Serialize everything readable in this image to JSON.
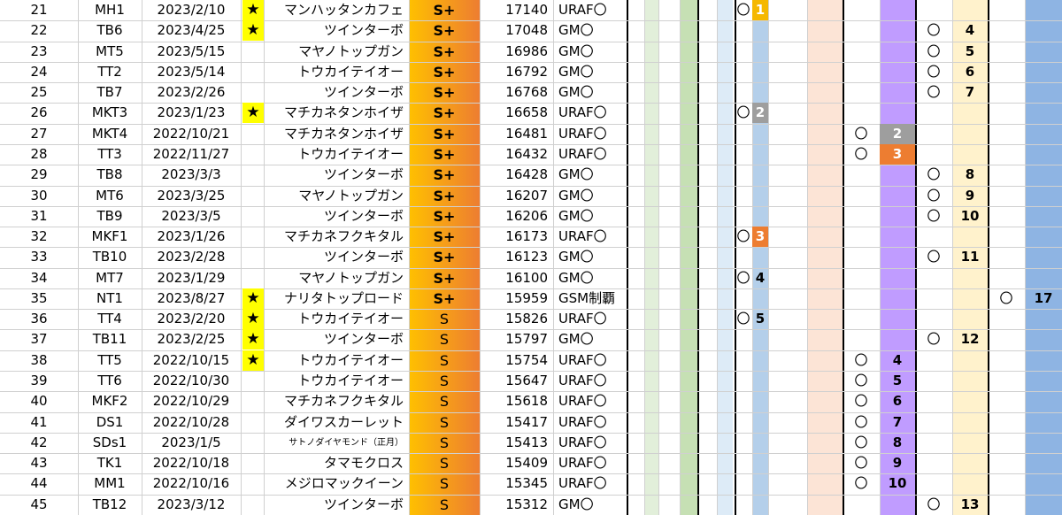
{
  "rows": [
    {
      "no": "21",
      "code": "MH1",
      "date": "2023/2/10",
      "star": "★",
      "name": "マンハッタンカフェ",
      "grade": "S+",
      "score": "17140",
      "cond": "URAF〇",
      "g2": "〇",
      "g2num": "1",
      "g2color": "#f5b800"
    },
    {
      "no": "22",
      "code": "TB6",
      "date": "2023/4/25",
      "star": "★",
      "name": "ツインターボ",
      "grade": "S+",
      "score": "17048",
      "cond": "GM〇",
      "g4": "〇",
      "g4num": "4"
    },
    {
      "no": "23",
      "code": "MT5",
      "date": "2023/5/15",
      "star": "",
      "name": "マヤノトップガン",
      "grade": "S+",
      "score": "16986",
      "cond": "GM〇",
      "g4": "〇",
      "g4num": "5"
    },
    {
      "no": "24",
      "code": "TT2",
      "date": "2023/5/14",
      "star": "",
      "name": "トウカイテイオー",
      "grade": "S+",
      "score": "16792",
      "cond": "GM〇",
      "g4": "〇",
      "g4num": "6"
    },
    {
      "no": "25",
      "code": "TB7",
      "date": "2023/2/26",
      "star": "",
      "name": "ツインターボ",
      "grade": "S+",
      "score": "16768",
      "cond": "GM〇",
      "g4": "〇",
      "g4num": "7"
    },
    {
      "no": "26",
      "code": "MKT3",
      "date": "2023/1/23",
      "star": "★",
      "name": "マチカネタンホイザ",
      "grade": "S+",
      "score": "16658",
      "cond": "URAF〇",
      "g2": "〇",
      "g2num": "2",
      "g2color": "#9e9e9e"
    },
    {
      "no": "27",
      "code": "MKT4",
      "date": "2022/10/21",
      "star": "",
      "name": "マチカネタンホイザ",
      "grade": "S+",
      "score": "16481",
      "cond": "URAF〇",
      "g3": "〇",
      "g3num": "2",
      "g3color": "#9e9e9e"
    },
    {
      "no": "28",
      "code": "TT3",
      "date": "2022/11/27",
      "star": "",
      "name": "トウカイテイオー",
      "grade": "S+",
      "score": "16432",
      "cond": "URAF〇",
      "g3": "〇",
      "g3num": "3",
      "g3color": "#ed7d31"
    },
    {
      "no": "29",
      "code": "TB8",
      "date": "2023/3/3",
      "star": "",
      "name": "ツインターボ",
      "grade": "S+",
      "score": "16428",
      "cond": "GM〇",
      "g4": "〇",
      "g4num": "8"
    },
    {
      "no": "30",
      "code": "MT6",
      "date": "2023/3/25",
      "star": "",
      "name": "マヤノトップガン",
      "grade": "S+",
      "score": "16207",
      "cond": "GM〇",
      "g4": "〇",
      "g4num": "9"
    },
    {
      "no": "31",
      "code": "TB9",
      "date": "2023/3/5",
      "star": "",
      "name": "ツインターボ",
      "grade": "S+",
      "score": "16206",
      "cond": "GM〇",
      "g4": "〇",
      "g4num": "10"
    },
    {
      "no": "32",
      "code": "MKF1",
      "date": "2023/1/26",
      "star": "",
      "name": "マチカネフクキタル",
      "grade": "S+",
      "score": "16173",
      "cond": "URAF〇",
      "g2": "〇",
      "g2num": "3",
      "g2color": "#ed7d31"
    },
    {
      "no": "33",
      "code": "TB10",
      "date": "2023/2/28",
      "star": "",
      "name": "ツインターボ",
      "grade": "S+",
      "score": "16123",
      "cond": "GM〇",
      "g4": "〇",
      "g4num": "11"
    },
    {
      "no": "34",
      "code": "MT7",
      "date": "2023/1/29",
      "star": "",
      "name": "マヤノトップガン",
      "grade": "S+",
      "score": "16100",
      "cond": "GM〇",
      "g2": "〇",
      "g2num": "4"
    },
    {
      "no": "35",
      "code": "NT1",
      "date": "2023/8/27",
      "star": "★",
      "name": "ナリタトップロード",
      "grade": "S+",
      "score": "15959",
      "cond": "GSM制覇",
      "g5": "〇",
      "g5num": "17"
    },
    {
      "no": "36",
      "code": "TT4",
      "date": "2023/2/20",
      "star": "★",
      "name": "トウカイテイオー",
      "grade": "S",
      "score": "15826",
      "cond": "URAF〇",
      "g2": "〇",
      "g2num": "5"
    },
    {
      "no": "37",
      "code": "TB11",
      "date": "2023/2/25",
      "star": "★",
      "name": "ツインターボ",
      "grade": "S",
      "score": "15797",
      "cond": "GM〇",
      "g4": "〇",
      "g4num": "12"
    },
    {
      "no": "38",
      "code": "TT5",
      "date": "2022/10/15",
      "star": "★",
      "name": "トウカイテイオー",
      "grade": "S",
      "score": "15754",
      "cond": "URAF〇",
      "g3": "〇",
      "g3num": "4"
    },
    {
      "no": "39",
      "code": "TT6",
      "date": "2022/10/30",
      "star": "",
      "name": "トウカイテイオー",
      "grade": "S",
      "score": "15647",
      "cond": "URAF〇",
      "g3": "〇",
      "g3num": "5"
    },
    {
      "no": "40",
      "code": "MKF2",
      "date": "2022/10/29",
      "star": "",
      "name": "マチカネフクキタル",
      "grade": "S",
      "score": "15618",
      "cond": "URAF〇",
      "g3": "〇",
      "g3num": "6"
    },
    {
      "no": "41",
      "code": "DS1",
      "date": "2022/10/28",
      "star": "",
      "name": "ダイワスカーレット",
      "grade": "S",
      "score": "15417",
      "cond": "URAF〇",
      "g3": "〇",
      "g3num": "7"
    },
    {
      "no": "42",
      "code": "SDs1",
      "date": "2023/1/5",
      "star": "",
      "name": "サトノダイヤモンド（正月）",
      "grade": "S",
      "score": "15413",
      "cond": "URAF〇",
      "g3": "〇",
      "g3num": "8",
      "smallname": true
    },
    {
      "no": "43",
      "code": "TK1",
      "date": "2022/10/18",
      "star": "",
      "name": "タマモクロス",
      "grade": "S",
      "score": "15409",
      "cond": "URAF〇",
      "g3": "〇",
      "g3num": "9"
    },
    {
      "no": "44",
      "code": "MM1",
      "date": "2022/10/16",
      "star": "",
      "name": "メジロマックイーン",
      "grade": "S",
      "score": "15345",
      "cond": "URAF〇",
      "g3": "〇",
      "g3num": "10"
    },
    {
      "no": "45",
      "code": "TB12",
      "date": "2023/3/12",
      "star": "",
      "name": "ツインターボ",
      "grade": "S",
      "score": "15312",
      "cond": "GM〇",
      "g4": "〇",
      "g4num": "13"
    }
  ],
  "colors": {
    "grade_gradient_start": "#ffc000",
    "grade_gradient_end": "#ed7d31",
    "star_bg": "#ffff00",
    "col_green_light": "#e2efda",
    "col_green": "#c6e0b4",
    "col_blue_light": "#ddebf7",
    "col_blue": "#b4cfea",
    "col_peach": "#fce4d6",
    "col_purple": "#c09cff",
    "col_cream": "#fff2cc",
    "col_blue_right": "#8eb4e3"
  }
}
